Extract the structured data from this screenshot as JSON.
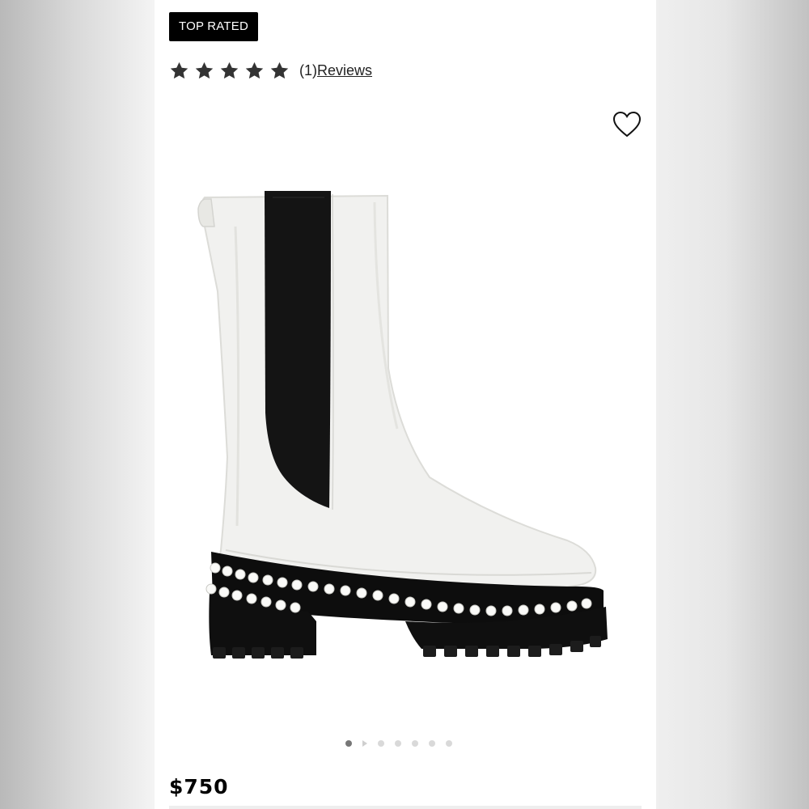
{
  "product": {
    "badge": "TOP RATED",
    "rating": {
      "stars": 5,
      "star_color": "#333333",
      "count_text": "(1)",
      "reviews_label": "Reviews"
    },
    "wishlist_icon": "heart-outline-icon",
    "image_alt": "white leather chelsea boot with black elastic panel and pearl-studded lug sole",
    "carousel": {
      "total_slides": 7,
      "active_index": 0
    },
    "price": "$750"
  },
  "colors": {
    "badge_bg": "#000000",
    "badge_text": "#ffffff",
    "page_bg": "#ffffff"
  }
}
